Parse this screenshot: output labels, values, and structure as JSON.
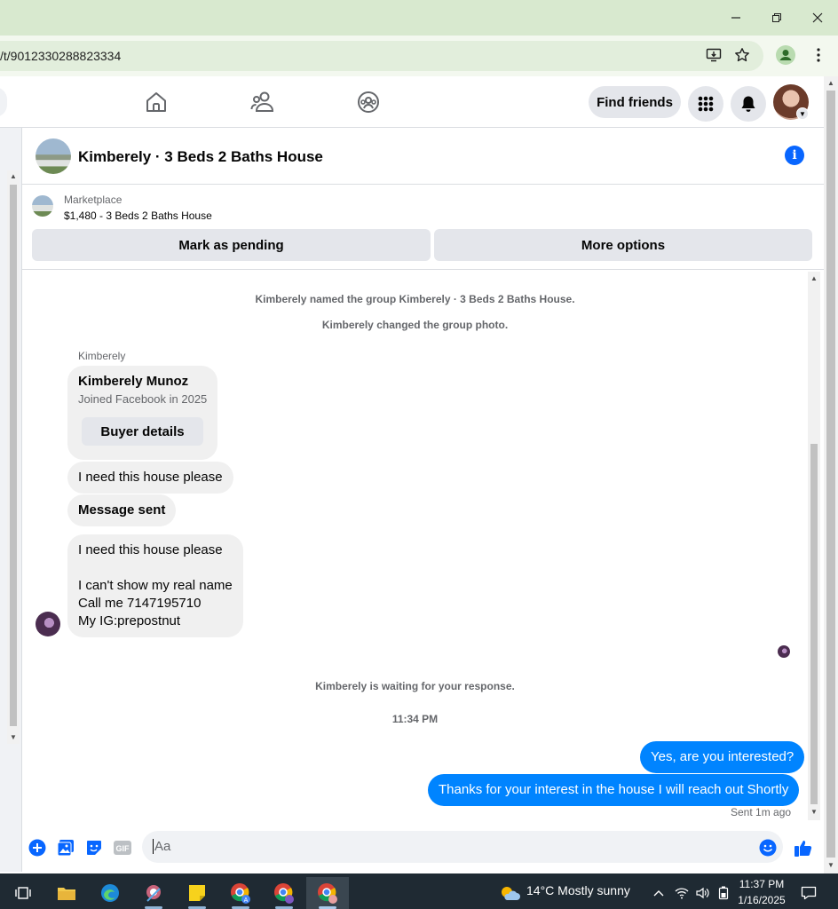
{
  "browser": {
    "url": "/t/9012330288823334"
  },
  "fb_nav": {
    "find_friends_label": "Find friends"
  },
  "chat": {
    "title": "Kimberely · 3 Beds 2 Baths House",
    "marketplace_label": "Marketplace",
    "listing": "$1,480 - 3 Beds 2 Baths House",
    "mark_pending_label": "Mark as pending",
    "more_options_label": "More options",
    "system_messages": [
      "Kimberely named the group Kimberely · 3 Beds 2 Baths House.",
      "Kimberely changed the group photo."
    ],
    "sender_name": "Kimberely",
    "profile_card": {
      "name": "Kimberely Munoz",
      "joined": "Joined Facebook in 2025",
      "button": "Buyer details"
    },
    "incoming": [
      "I need this house please",
      "Message sent"
    ],
    "long_message": {
      "line1": "I need this house please",
      "line2": "I can't show my real name",
      "line3": "Call me 7147195710",
      "line4": "My IG:prepostnut"
    },
    "waiting_text": "Kimberely is waiting for your response.",
    "timestamp": "11:34 PM",
    "outgoing": [
      "Yes, are you interested?",
      "Thanks for your interest in the house I will reach out Shortly"
    ],
    "sent_status": "Sent 1m ago",
    "composer_placeholder": "Aa"
  },
  "taskbar": {
    "weather": "14°C  Mostly sunny",
    "time": "11:37 PM",
    "date": "1/16/2025"
  },
  "colors": {
    "messenger_blue": "#0084ff",
    "fb_blue": "#0866ff",
    "bubble_grey": "#f0f0f0"
  }
}
